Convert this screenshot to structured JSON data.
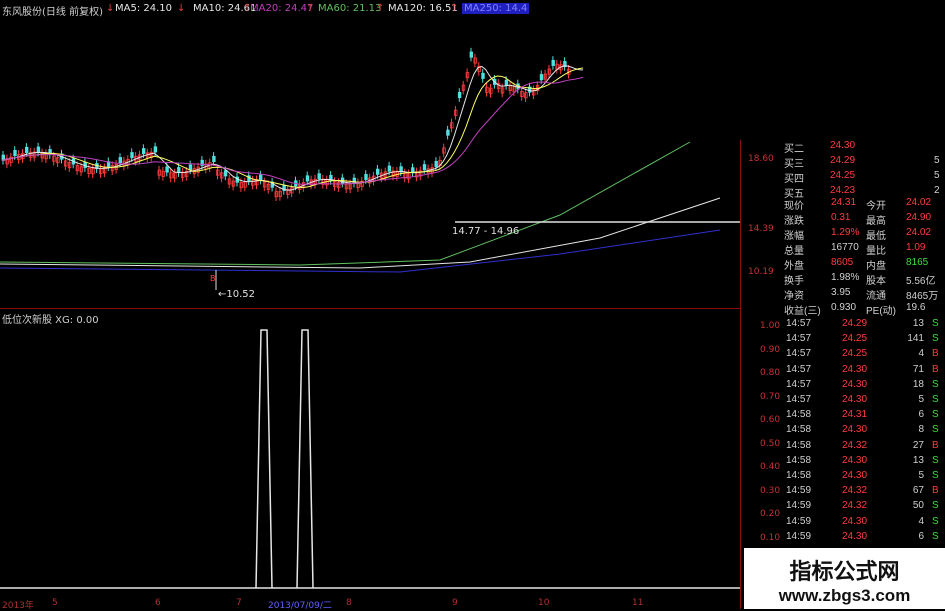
{
  "header": {
    "stock_title": "东风股份(日线 前复权)",
    "ma": [
      {
        "label": "MA5: 24.10",
        "color": "#e6e6e6",
        "arrow": "↓",
        "arrow_color": "#e6e6e6"
      },
      {
        "label": "MA10: 24.61",
        "color": "#e6e6e6",
        "arrow": "↑",
        "arrow_color": "#e04040"
      },
      {
        "label": "MA20: 24.47",
        "color": "#c040c0",
        "arrow": "↑",
        "arrow_color": "#e04040"
      },
      {
        "label": "MA60: 21.13",
        "color": "#60c060",
        "arrow": "↑",
        "arrow_color": "#e04040"
      },
      {
        "label": "MA120: 16.51",
        "color": "#e6e6e6",
        "arrow": "↑",
        "arrow_color": "#e04040"
      },
      {
        "label": "MA250: 14.4",
        "color": "#5050ff",
        "arrow": "",
        "arrow_color": "#5050ff"
      }
    ]
  },
  "main_chart": {
    "annotations": {
      "low_label": "←10.52",
      "range_label": "14.77 - 14.96",
      "b_marker": "B"
    },
    "price_axis": [
      "18.60",
      "14.39",
      "10.19"
    ]
  },
  "indicator": {
    "title": "低位次新股 XG: 0.00",
    "axis": [
      "1.00",
      "0.90",
      "0.80",
      "0.70",
      "0.60",
      "0.50",
      "0.40",
      "0.30",
      "0.20",
      "0.10"
    ],
    "signals": [
      {
        "date_index": 5.6
      },
      {
        "date_index": 6.5
      }
    ]
  },
  "date_axis": [
    "2013年",
    "5",
    "6",
    "7",
    "2013/07/09/二",
    "8",
    "9",
    "10",
    "11"
  ],
  "order_book": [
    {
      "label": "买二",
      "price": "24.30",
      "vol": ""
    },
    {
      "label": "买三",
      "price": "24.29",
      "vol": "5"
    },
    {
      "label": "买四",
      "price": "24.25",
      "vol": "5"
    },
    {
      "label": "买五",
      "price": "24.23",
      "vol": "2"
    }
  ],
  "quote": [
    {
      "l1": "现价",
      "v1": "24.31",
      "l2": "今开",
      "v2": "24.02"
    },
    {
      "l1": "涨跌",
      "v1": "0.31",
      "l2": "最高",
      "v2": "24.90"
    },
    {
      "l1": "涨幅",
      "v1": "1.29%",
      "l2": "最低",
      "v2": "24.02"
    },
    {
      "l1": "总量",
      "v1": "16770",
      "l2": "量比",
      "v2": "1.09"
    },
    {
      "l1": "外盘",
      "v1": "8605",
      "l2": "内盘",
      "v2": "8165"
    },
    {
      "l1": "换手",
      "v1": "1.98%",
      "l2": "股本",
      "v2": "5.56亿"
    },
    {
      "l1": "净资",
      "v1": "3.95",
      "l2": "流通",
      "v2": "8465万"
    },
    {
      "l1": "收益(三)",
      "v1": "0.930",
      "l2": "PE(动)",
      "v2": "19.6"
    }
  ],
  "ticks": [
    {
      "time": "14:57",
      "price": "24.29",
      "vol": "13",
      "side": "S"
    },
    {
      "time": "14:57",
      "price": "24.25",
      "vol": "141",
      "side": "S"
    },
    {
      "time": "14:57",
      "price": "24.25",
      "vol": "4",
      "side": "B"
    },
    {
      "time": "14:57",
      "price": "24.30",
      "vol": "71",
      "side": "B"
    },
    {
      "time": "14:57",
      "price": "24.30",
      "vol": "18",
      "side": "S"
    },
    {
      "time": "14:57",
      "price": "24.30",
      "vol": "5",
      "side": "S"
    },
    {
      "time": "14:58",
      "price": "24.31",
      "vol": "6",
      "side": "S"
    },
    {
      "time": "14:58",
      "price": "24.30",
      "vol": "8",
      "side": "S"
    },
    {
      "time": "14:58",
      "price": "24.32",
      "vol": "27",
      "side": "B"
    },
    {
      "time": "14:58",
      "price": "24.30",
      "vol": "13",
      "side": "S"
    },
    {
      "time": "14:58",
      "price": "24.30",
      "vol": "5",
      "side": "S"
    },
    {
      "time": "14:59",
      "price": "24.32",
      "vol": "67",
      "side": "B"
    },
    {
      "time": "14:59",
      "price": "24.32",
      "vol": "50",
      "side": "S"
    },
    {
      "time": "14:59",
      "price": "24.30",
      "vol": "4",
      "side": "S"
    },
    {
      "time": "14:59",
      "price": "24.30",
      "vol": "6",
      "side": "S"
    }
  ],
  "watermark": {
    "title": "指标公式网",
    "url": "www.zbgs3.com"
  },
  "colors": {
    "up": "#ff3c3c",
    "down": "#50e0e0",
    "axis": "#8a1010",
    "buy": "#ff3c3c",
    "sell": "#3cdc3c"
  }
}
